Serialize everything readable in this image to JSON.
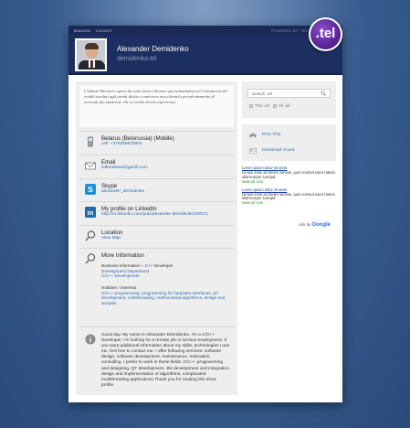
{
  "topbar": {
    "links": [
      "MANAGE",
      "LOGOUT"
    ],
    "powered": "POWERED BY .TEL"
  },
  "profile": {
    "name": "Alexander Demidenko",
    "domain": "demidenko.tel",
    "logo": ".tel"
  },
  "intro": "L'istituto Mercurio opera da molti anni colloruso specializzandosi nel ristrunocio dei crediti insoluti agli aventi diritto e annovera una clientela prevalentemente di avvocati più numerose che si avvale di tale esperienza.",
  "contacts": [
    {
      "icon": "mobile-phone-icon",
      "title": "Belarus (Belorussia) (Mobile)",
      "value": "cell: +375259578901"
    },
    {
      "icon": "envelope-icon",
      "title": "Email",
      "value": "lelbarebara@gamil.com"
    },
    {
      "icon": "skype-icon",
      "title": "Skype",
      "value": "alexander_demidenko"
    },
    {
      "icon": "linkedin-icon",
      "title": "My profile on LinkedIn",
      "value": "http://ru.linkedin.com/pub/alexander-demidenko/29/371"
    },
    {
      "icon": "location-pin-icon",
      "title": "Location",
      "value": "View Map"
    }
  ],
  "more": {
    "title": "More Information",
    "business_label": "Business information – C++ Developer",
    "business_links": [
      "Development Department",
      "C/C++ Development"
    ],
    "hobbies_label": "Hobbies / Interests",
    "hobbies_text": "C/C++ programming, programming for hardware interfaces, QT development, multithreading, mathematical algorithms, design and analysis."
  },
  "about": "Good day. My name is Alexander Demidenko. I'm a C/C++ Developer. I'm looking for a remote job or serious employment. If you want additional information about my skills, technologies I use etc. feel free to contact me. I offer following services: software design, software development, maintenance, estimation, consulting. I prefer to work in these fields: C/C++ programming and designing, QT development, JNI development and integration, design and implementation of algorithms, complicated multithreading applications.Thank you for reading this short profile.",
  "search": {
    "placeholder": "Search .tel",
    "options": [
      "This .tel",
      "All .tel"
    ]
  },
  "actions": {
    "print": "Print This",
    "vcard": "Download vCard"
  },
  "ads": [
    {
      "title": "Lorem ipsum dolor sit amet",
      "desc": "Ut wisi enim ad minim veniam, quis nostrud exerci tation ullamcorper suscipit.",
      "url": "www.url.com"
    },
    {
      "title": "Lorem ipsum dolor sit amet",
      "desc": "Ut wisi enim ad minim veniam, quis nostrud exerci tation ullamcorper suscipit.",
      "url": "www.url.com"
    }
  ],
  "adsby": {
    "prefix": "Ads by",
    "brand": "Google"
  },
  "colors": {
    "header": "#1c2f60",
    "link": "#2a6bb5",
    "background": "#3a5f93",
    "logo": "#5a2596"
  }
}
